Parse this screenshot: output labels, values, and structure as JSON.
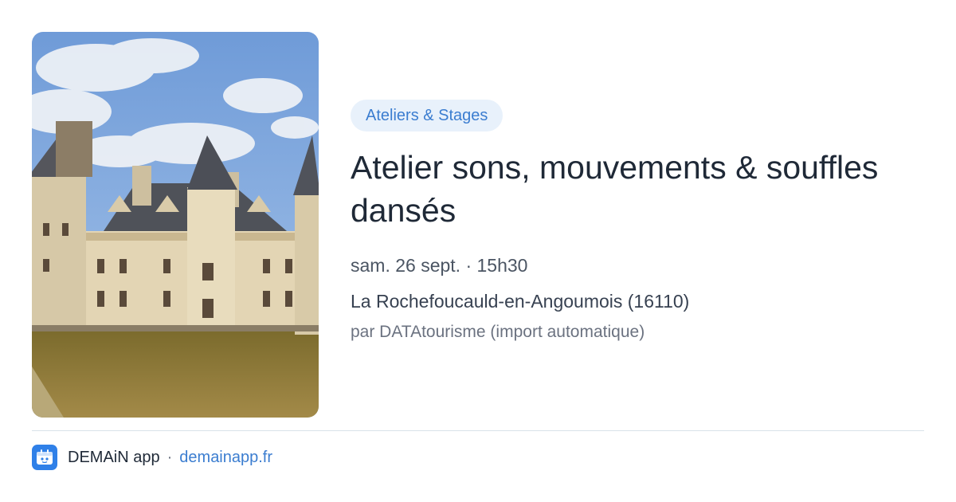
{
  "event": {
    "image_alt": "Château de La Rochefoucauld",
    "category": "Ateliers & Stages",
    "title": "Atelier sons, mouvements & souffles dansés",
    "date": "sam. 26 sept. · 15h30",
    "location": "La Rochefoucauld-en-Angoumois (16110)",
    "source": "par DATAtourisme (import automatique)"
  },
  "footer": {
    "app_icon": "demain-app-icon",
    "app_name": "DEMAiN app",
    "separator": "·",
    "url": "demainapp.fr"
  },
  "colors": {
    "accent": "#3b7dd0",
    "chip_bg": "#e8f1fb",
    "title": "#1f2937",
    "muted": "#6b7280",
    "divider": "#d9e2ea"
  }
}
